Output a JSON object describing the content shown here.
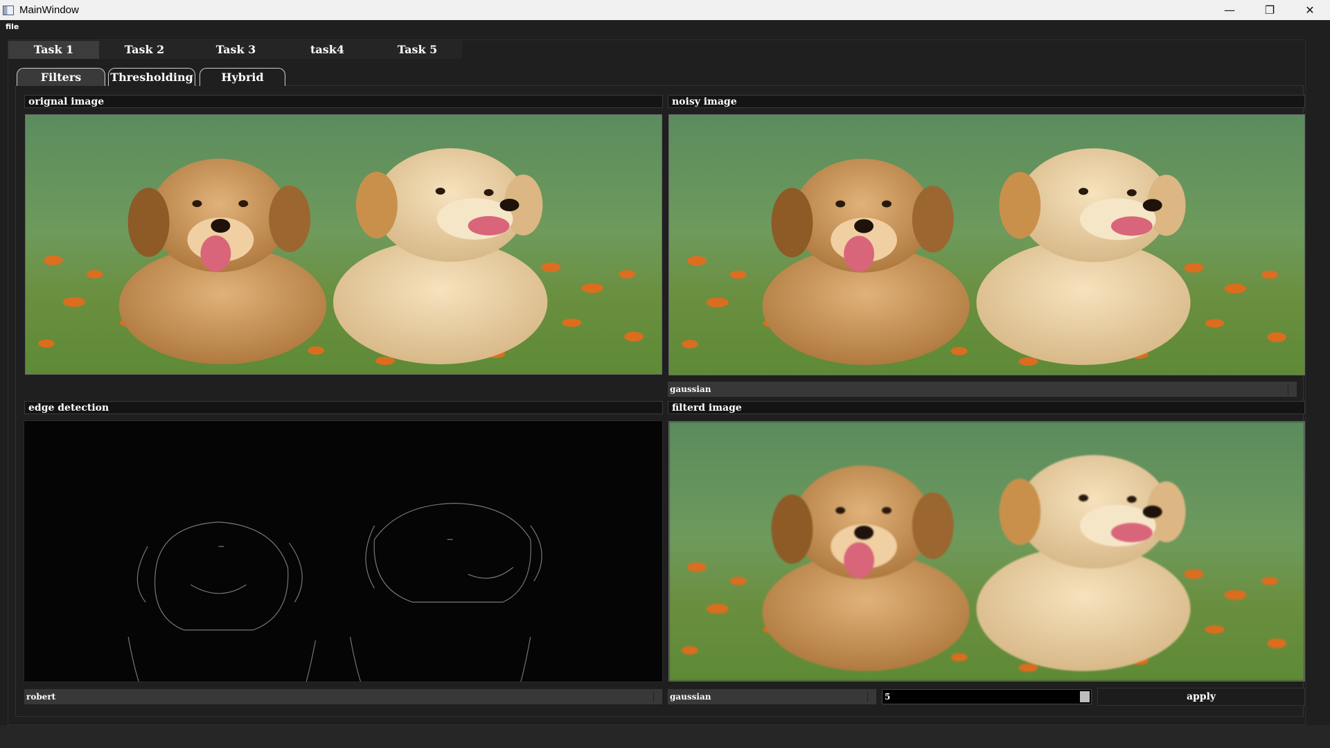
{
  "window": {
    "title": "MainWindow",
    "minimize_glyph": "—",
    "restore_glyph": "❐",
    "close_glyph": "✕"
  },
  "menu": {
    "file": "file"
  },
  "top_tabs": [
    {
      "label": "Task 1",
      "active": true
    },
    {
      "label": "Task 2"
    },
    {
      "label": "Task 3"
    },
    {
      "label": "task4"
    },
    {
      "label": "Task 5"
    }
  ],
  "sub_tabs": [
    {
      "label": "Filters",
      "active": true
    },
    {
      "label": "Thresholding"
    },
    {
      "label": "Hybrid"
    }
  ],
  "panels": {
    "original": {
      "label": "orignal image"
    },
    "noisy": {
      "label": "noisy image",
      "noise_type": "gaussian"
    },
    "edge": {
      "label": "edge detection",
      "method": "robert"
    },
    "filtered": {
      "label": "filterd image",
      "filter_type": "gaussian",
      "kernel_size": "5",
      "apply_label": "apply"
    }
  },
  "colors": {
    "window_bg": "#1f1f1f",
    "titlebar_bg": "#f0f0f0",
    "active_tab": "#3c3c3c",
    "dropdown_bg": "#383838"
  }
}
